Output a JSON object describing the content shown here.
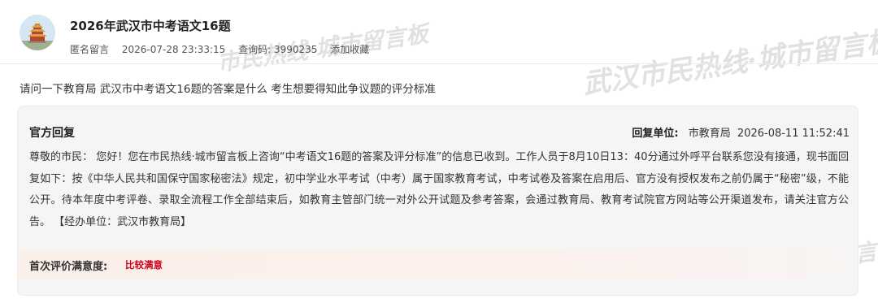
{
  "post": {
    "title": "2026年武汉市中考语文16题",
    "author": "匿名留言",
    "datetime": "2026-07-28 23:33:15",
    "query_code": "查询码: 3990235",
    "favorite_label": "添加收藏",
    "question": "请问一下教育局 武汉市中考语文16题的答案是什么 考生想要得知此争议题的评分标准"
  },
  "reply": {
    "label": "官方回复",
    "unit_label": "回复单位:",
    "unit_value": "市教育局",
    "time": "2026-08-11 11:52:41",
    "body": "尊敬的市民：  您好！您在市民热线·城市留言板上咨询“中考语文16题的答案及评分标准”的信息已收到。工作人员于8月10日13：40分通过外呼平台联系您没有接通，现书面回复如下：按《中华人民共和国保守国家秘密法》规定，初中学业水平考试（中考）属于国家教育考试，中考试卷及答案在启用后、官方没有授权发布之前仍属于“秘密”级，不能公开。待本年度中考评卷、录取全流程工作全部结束后，如教育主管部门统一对外公开试题及参考答案，会通过教育局、教育考试院官方网站等公开渠道发布，请关注官方公告。 【经办单位：武汉市教育局】",
    "rating_label": "首次评价满意度:",
    "rating_value": "比较满意"
  },
  "watermark": {
    "text_short": "市民热线·城市留言板",
    "text_long": "武汉市民热线·城市留言板"
  },
  "colors": {
    "accent_red": "#d0021b",
    "panel_bg": "#f5f5f5",
    "rating_bg": "#fbefea"
  }
}
